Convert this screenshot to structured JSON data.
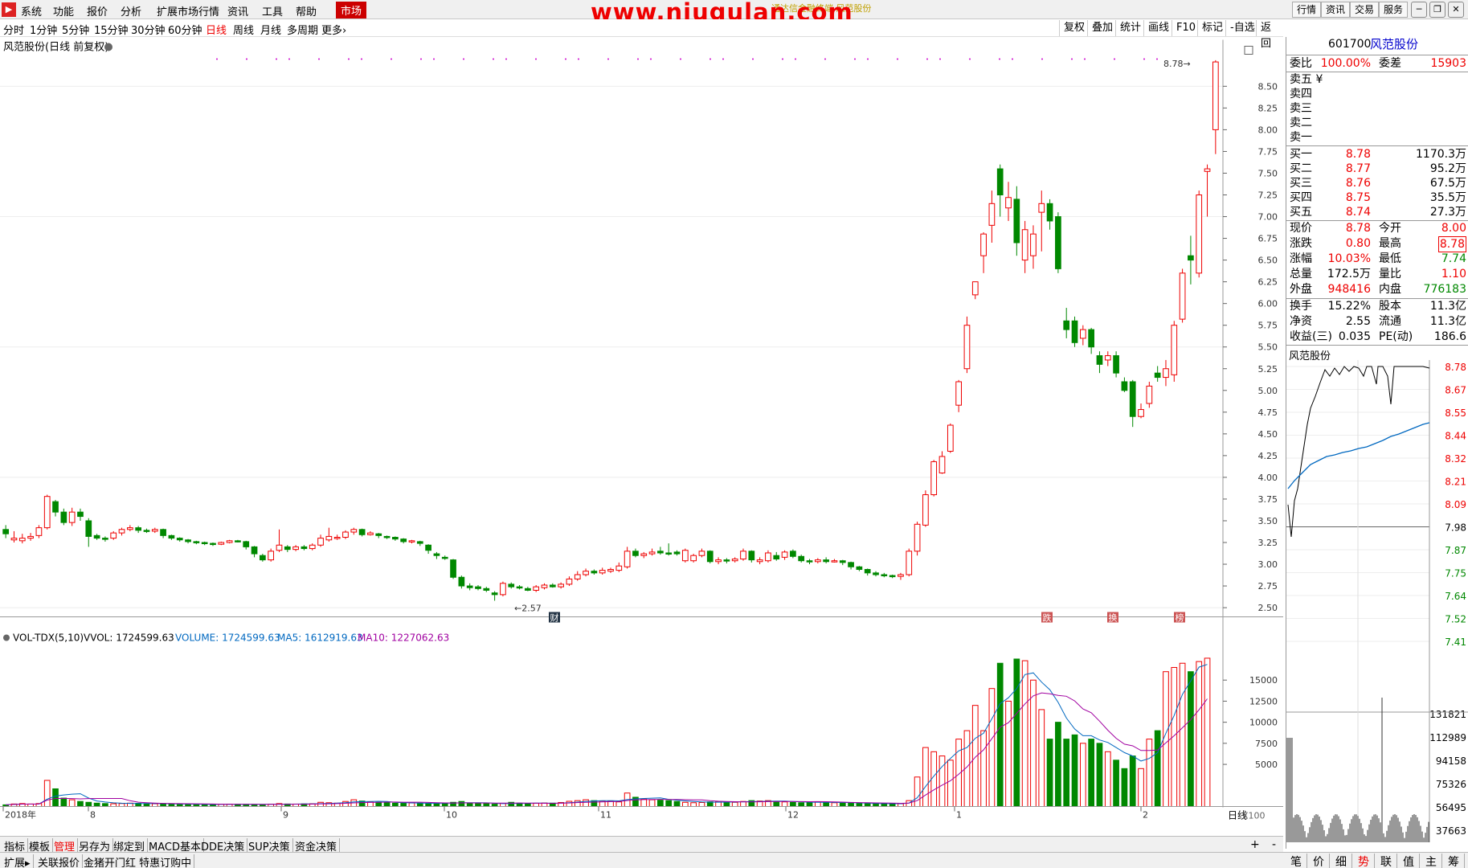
{
  "menubar": {
    "items": [
      "系统",
      "功能",
      "报价",
      "分析",
      "扩展市场行情",
      "资讯",
      "工具",
      "帮助"
    ],
    "active": "市场",
    "watermark": "www.niugulan.com",
    "title_faint": "通达信金融终端 风范股份",
    "right_tools": [
      "行情",
      "资讯",
      "交易",
      "服务"
    ]
  },
  "periodbar": {
    "items": [
      "分时",
      "1分钟",
      "5分钟",
      "15分钟",
      "30分钟",
      "60分钟",
      "日线",
      "周线",
      "月线",
      "多周期",
      "更多"
    ],
    "active": "日线",
    "tools": [
      "复权",
      "叠加",
      "统计",
      "画线",
      "F10",
      "标记",
      "-自选",
      "返回"
    ]
  },
  "chart": {
    "title": "风范股份(日线 前复权)",
    "high_label": "8.78",
    "low_label": "2.57",
    "y_ticks": [
      "8.50",
      "8.25",
      "8.00",
      "7.75",
      "7.50",
      "7.25",
      "7.00",
      "6.75",
      "6.50",
      "6.25",
      "6.00",
      "5.75",
      "5.50",
      "5.25",
      "5.00",
      "4.75",
      "4.50",
      "4.25",
      "4.00",
      "3.75",
      "3.50",
      "3.25",
      "3.00",
      "2.75",
      "2.50"
    ],
    "event_tags": [
      "财",
      "跌",
      "换",
      "榜"
    ],
    "vol_header": {
      "name": "VOL-TDX(5,10)",
      "vvol": "VVOL: 1724599.63",
      "volume": "VOLUME: 1724599.63",
      "ma5": "MA5: 1612919.63",
      "ma10": "MA10: 1227062.63"
    },
    "vol_ticks": [
      "15000",
      "12500",
      "10000",
      "7500",
      "5000"
    ],
    "vol_unit": "X100",
    "x_labels": [
      "2018年",
      "8",
      "9",
      "10",
      "11",
      "12",
      "1",
      "2"
    ],
    "period_label": "日线"
  },
  "chart_data": {
    "type": "candlestick",
    "ylim": [
      2.45,
      8.85
    ],
    "candles": [
      [
        3.4,
        3.35,
        3.45,
        3.3,
        0
      ],
      [
        3.3,
        3.28,
        3.38,
        3.25,
        1
      ],
      [
        3.27,
        3.3,
        3.35,
        3.24,
        1
      ],
      [
        3.3,
        3.32,
        3.36,
        3.27,
        1
      ],
      [
        3.33,
        3.42,
        3.45,
        3.3,
        1
      ],
      [
        3.42,
        3.78,
        3.8,
        3.4,
        1
      ],
      [
        3.72,
        3.6,
        3.74,
        3.55,
        0
      ],
      [
        3.6,
        3.48,
        3.64,
        3.45,
        0
      ],
      [
        3.48,
        3.6,
        3.65,
        3.44,
        1
      ],
      [
        3.6,
        3.55,
        3.64,
        3.5,
        0
      ],
      [
        3.5,
        3.32,
        3.53,
        3.2,
        0
      ],
      [
        3.33,
        3.3,
        3.35,
        3.28,
        0
      ],
      [
        3.3,
        3.29,
        3.32,
        3.26,
        0
      ],
      [
        3.3,
        3.36,
        3.38,
        3.28,
        1
      ],
      [
        3.36,
        3.4,
        3.42,
        3.33,
        1
      ],
      [
        3.4,
        3.42,
        3.45,
        3.38,
        1
      ],
      [
        3.42,
        3.39,
        3.44,
        3.36,
        0
      ],
      [
        3.39,
        3.38,
        3.41,
        3.36,
        0
      ],
      [
        3.38,
        3.4,
        3.42,
        3.36,
        1
      ],
      [
        3.4,
        3.33,
        3.41,
        3.3,
        0
      ],
      [
        3.33,
        3.3,
        3.34,
        3.28,
        0
      ],
      [
        3.3,
        3.28,
        3.31,
        3.26,
        0
      ],
      [
        3.28,
        3.26,
        3.29,
        3.24,
        0
      ],
      [
        3.26,
        3.25,
        3.27,
        3.23,
        0
      ],
      [
        3.25,
        3.24,
        3.26,
        3.22,
        0
      ],
      [
        3.24,
        3.23,
        3.25,
        3.21,
        0
      ],
      [
        3.23,
        3.25,
        3.26,
        3.22,
        1
      ],
      [
        3.25,
        3.27,
        3.28,
        3.24,
        1
      ],
      [
        3.27,
        3.26,
        3.28,
        3.25,
        0
      ],
      [
        3.26,
        3.2,
        3.27,
        3.17,
        0
      ],
      [
        3.2,
        3.12,
        3.21,
        3.08,
        0
      ],
      [
        3.1,
        3.05,
        3.12,
        3.03,
        0
      ],
      [
        3.05,
        3.15,
        3.18,
        3.03,
        1
      ],
      [
        3.16,
        3.22,
        3.4,
        3.14,
        1
      ],
      [
        3.2,
        3.17,
        3.22,
        3.14,
        0
      ],
      [
        3.17,
        3.2,
        3.22,
        3.15,
        1
      ],
      [
        3.2,
        3.18,
        3.22,
        3.16,
        0
      ],
      [
        3.18,
        3.22,
        3.24,
        3.16,
        1
      ],
      [
        3.22,
        3.3,
        3.34,
        3.2,
        1
      ],
      [
        3.28,
        3.32,
        3.42,
        3.26,
        1
      ],
      [
        3.3,
        3.31,
        3.34,
        3.28,
        1
      ],
      [
        3.31,
        3.37,
        3.39,
        3.29,
        1
      ],
      [
        3.37,
        3.4,
        3.42,
        3.34,
        1
      ],
      [
        3.4,
        3.34,
        3.41,
        3.32,
        0
      ],
      [
        3.34,
        3.36,
        3.38,
        3.33,
        1
      ],
      [
        3.35,
        3.33,
        3.36,
        3.3,
        0
      ],
      [
        3.32,
        3.31,
        3.33,
        3.29,
        0
      ],
      [
        3.31,
        3.29,
        3.32,
        3.27,
        0
      ],
      [
        3.29,
        3.26,
        3.3,
        3.24,
        0
      ],
      [
        3.26,
        3.27,
        3.28,
        3.24,
        1
      ],
      [
        3.26,
        3.24,
        3.27,
        3.21,
        0
      ],
      [
        3.22,
        3.16,
        3.23,
        3.12,
        0
      ],
      [
        3.12,
        3.1,
        3.14,
        3.06,
        0
      ],
      [
        3.08,
        3.08,
        3.1,
        3.05,
        0
      ],
      [
        3.05,
        2.85,
        3.06,
        2.83,
        0
      ],
      [
        2.85,
        2.75,
        2.87,
        2.72,
        0
      ],
      [
        2.75,
        2.73,
        2.78,
        2.7,
        0
      ],
      [
        2.74,
        2.72,
        2.76,
        2.7,
        0
      ],
      [
        2.72,
        2.7,
        2.74,
        2.68,
        0
      ],
      [
        2.67,
        2.65,
        2.69,
        2.58,
        0
      ],
      [
        2.65,
        2.78,
        2.8,
        2.63,
        1
      ],
      [
        2.77,
        2.74,
        2.79,
        2.72,
        0
      ],
      [
        2.74,
        2.73,
        2.76,
        2.71,
        0
      ],
      [
        2.72,
        2.7,
        2.74,
        2.69,
        0
      ],
      [
        2.7,
        2.74,
        2.76,
        2.68,
        1
      ],
      [
        2.73,
        2.76,
        2.78,
        2.71,
        1
      ],
      [
        2.76,
        2.74,
        2.78,
        2.73,
        0
      ],
      [
        2.74,
        2.77,
        2.79,
        2.72,
        1
      ],
      [
        2.77,
        2.83,
        2.86,
        2.75,
        1
      ],
      [
        2.83,
        2.88,
        2.92,
        2.81,
        1
      ],
      [
        2.88,
        2.92,
        2.95,
        2.86,
        1
      ],
      [
        2.92,
        2.9,
        2.94,
        2.88,
        0
      ],
      [
        2.9,
        2.93,
        2.96,
        2.88,
        1
      ],
      [
        2.92,
        2.94,
        2.96,
        2.9,
        1
      ],
      [
        2.93,
        2.98,
        3.02,
        2.91,
        1
      ],
      [
        2.97,
        3.15,
        3.2,
        2.95,
        1
      ],
      [
        3.15,
        3.1,
        3.18,
        3.08,
        0
      ],
      [
        3.1,
        3.12,
        3.14,
        3.07,
        1
      ],
      [
        3.12,
        3.14,
        3.18,
        3.1,
        1
      ],
      [
        3.15,
        3.13,
        3.2,
        3.11,
        0
      ],
      [
        3.13,
        3.12,
        3.24,
        3.1,
        0
      ],
      [
        3.14,
        3.12,
        3.16,
        3.1,
        0
      ],
      [
        3.16,
        3.04,
        3.18,
        3.02,
        1
      ],
      [
        3.04,
        3.1,
        3.12,
        3.02,
        1
      ],
      [
        3.1,
        3.15,
        3.18,
        3.08,
        1
      ],
      [
        3.15,
        3.03,
        3.16,
        3.01,
        0
      ],
      [
        3.03,
        3.05,
        3.08,
        3.0,
        1
      ],
      [
        3.05,
        3.04,
        3.07,
        3.01,
        0
      ],
      [
        3.04,
        3.06,
        3.08,
        3.02,
        1
      ],
      [
        3.06,
        3.15,
        3.18,
        3.04,
        1
      ],
      [
        3.15,
        3.05,
        3.16,
        3.02,
        0
      ],
      [
        3.05,
        3.03,
        3.08,
        3.0,
        1
      ],
      [
        3.04,
        3.13,
        3.16,
        3.02,
        1
      ],
      [
        3.1,
        3.06,
        3.14,
        3.04,
        0
      ],
      [
        3.08,
        3.14,
        3.16,
        3.05,
        1
      ],
      [
        3.15,
        3.09,
        3.17,
        3.07,
        0
      ],
      [
        3.09,
        3.04,
        3.11,
        3.02,
        0
      ],
      [
        3.04,
        3.03,
        3.06,
        3.0,
        0
      ],
      [
        3.03,
        3.05,
        3.07,
        3.01,
        1
      ],
      [
        3.05,
        3.03,
        3.08,
        3.01,
        0
      ],
      [
        3.03,
        3.04,
        3.06,
        3.02,
        1
      ],
      [
        3.04,
        3.02,
        3.05,
        2.99,
        0
      ],
      [
        3.02,
        2.97,
        3.03,
        2.94,
        0
      ],
      [
        2.97,
        2.94,
        2.98,
        2.92,
        0
      ],
      [
        2.94,
        2.9,
        2.95,
        2.87,
        0
      ],
      [
        2.9,
        2.88,
        2.92,
        2.86,
        0
      ],
      [
        2.88,
        2.87,
        2.9,
        2.85,
        0
      ],
      [
        2.87,
        2.86,
        2.88,
        2.84,
        0
      ],
      [
        2.86,
        2.88,
        2.9,
        2.82,
        1
      ],
      [
        2.88,
        3.15,
        3.18,
        2.86,
        1
      ],
      [
        3.15,
        3.46,
        3.49,
        3.1,
        1
      ],
      [
        3.45,
        3.8,
        3.85,
        3.43,
        1
      ],
      [
        3.8,
        4.18,
        4.2,
        3.78,
        1
      ],
      [
        4.05,
        4.24,
        4.3,
        4.04,
        1
      ],
      [
        4.3,
        4.6,
        4.62,
        4.28,
        1
      ],
      [
        4.83,
        5.1,
        5.12,
        4.75,
        1
      ],
      [
        5.25,
        5.75,
        5.85,
        5.2,
        1
      ],
      [
        6.1,
        6.25,
        6.15,
        6.05,
        1
      ],
      [
        6.55,
        6.8,
        6.82,
        6.35,
        1
      ],
      [
        6.9,
        7.15,
        7.3,
        6.7,
        1
      ],
      [
        7.55,
        7.25,
        7.6,
        7.0,
        0
      ],
      [
        7.1,
        7.22,
        7.4,
        6.95,
        1
      ],
      [
        7.2,
        6.7,
        7.35,
        6.55,
        0
      ],
      [
        6.5,
        6.85,
        6.95,
        6.35,
        1
      ],
      [
        6.8,
        6.55,
        6.9,
        6.4,
        1
      ],
      [
        7.05,
        7.15,
        7.3,
        6.6,
        1
      ],
      [
        7.15,
        6.95,
        7.2,
        6.85,
        0
      ],
      [
        7.0,
        6.4,
        7.05,
        6.35,
        0
      ],
      [
        5.8,
        5.7,
        5.95,
        5.6,
        0
      ],
      [
        5.8,
        5.55,
        5.85,
        5.5,
        0
      ],
      [
        5.6,
        5.7,
        5.75,
        5.52,
        1
      ],
      [
        5.7,
        5.5,
        5.72,
        5.42,
        0
      ],
      [
        5.4,
        5.3,
        5.45,
        5.2,
        0
      ],
      [
        5.35,
        5.4,
        5.45,
        5.28,
        1
      ],
      [
        5.4,
        5.2,
        5.45,
        5.15,
        0
      ],
      [
        5.1,
        5.0,
        5.15,
        4.98,
        0
      ],
      [
        5.1,
        4.7,
        5.12,
        4.58,
        0
      ],
      [
        4.7,
        4.78,
        4.85,
        4.68,
        1
      ],
      [
        4.85,
        5.05,
        5.1,
        4.8,
        1
      ],
      [
        5.2,
        5.15,
        5.28,
        5.1,
        0
      ],
      [
        5.15,
        5.25,
        5.35,
        5.05,
        1
      ],
      [
        5.18,
        5.75,
        5.8,
        5.1,
        1
      ],
      [
        5.82,
        6.35,
        6.4,
        5.78,
        1
      ],
      [
        6.55,
        6.5,
        6.78,
        6.22,
        0
      ],
      [
        6.35,
        7.25,
        7.3,
        6.3,
        1
      ],
      [
        7.52,
        7.55,
        7.6,
        7.0,
        1
      ],
      [
        8.0,
        8.78,
        8.8,
        7.72,
        1
      ]
    ],
    "volume": [
      200,
      300,
      350,
      300,
      350,
      3100,
      2100,
      1000,
      800,
      600,
      500,
      400,
      350,
      330,
      360,
      400,
      380,
      350,
      330,
      320,
      300,
      280,
      260,
      250,
      240,
      230,
      250,
      280,
      270,
      260,
      240,
      230,
      280,
      350,
      300,
      290,
      310,
      330,
      500,
      450,
      400,
      600,
      800,
      650,
      550,
      500,
      450,
      400,
      380,
      420,
      400,
      350,
      380,
      420,
      500,
      600,
      400,
      350,
      330,
      280,
      380,
      500,
      400,
      350,
      380,
      420,
      400,
      480,
      620,
      700,
      800,
      700,
      650,
      620,
      550,
      1600,
      1100,
      900,
      800,
      750,
      700,
      600,
      500,
      450,
      480,
      550,
      600,
      550,
      500,
      600,
      700,
      650,
      700,
      600,
      550,
      500,
      450,
      480,
      550,
      500,
      450,
      420,
      400,
      380,
      350,
      330,
      320,
      350,
      330,
      700,
      3500,
      7000,
      6500,
      6000,
      5500,
      8000,
      9000,
      12000,
      9000,
      14000,
      17000,
      12500,
      17500,
      17300,
      15000,
      11500,
      8000,
      10000,
      8000,
      8500,
      7500,
      8000,
      7500,
      6500,
      5500,
      4500,
      6000,
      4500,
      8000,
      9000,
      16000,
      16500,
      17000,
      16000,
      17200,
      17600
    ]
  }
}
